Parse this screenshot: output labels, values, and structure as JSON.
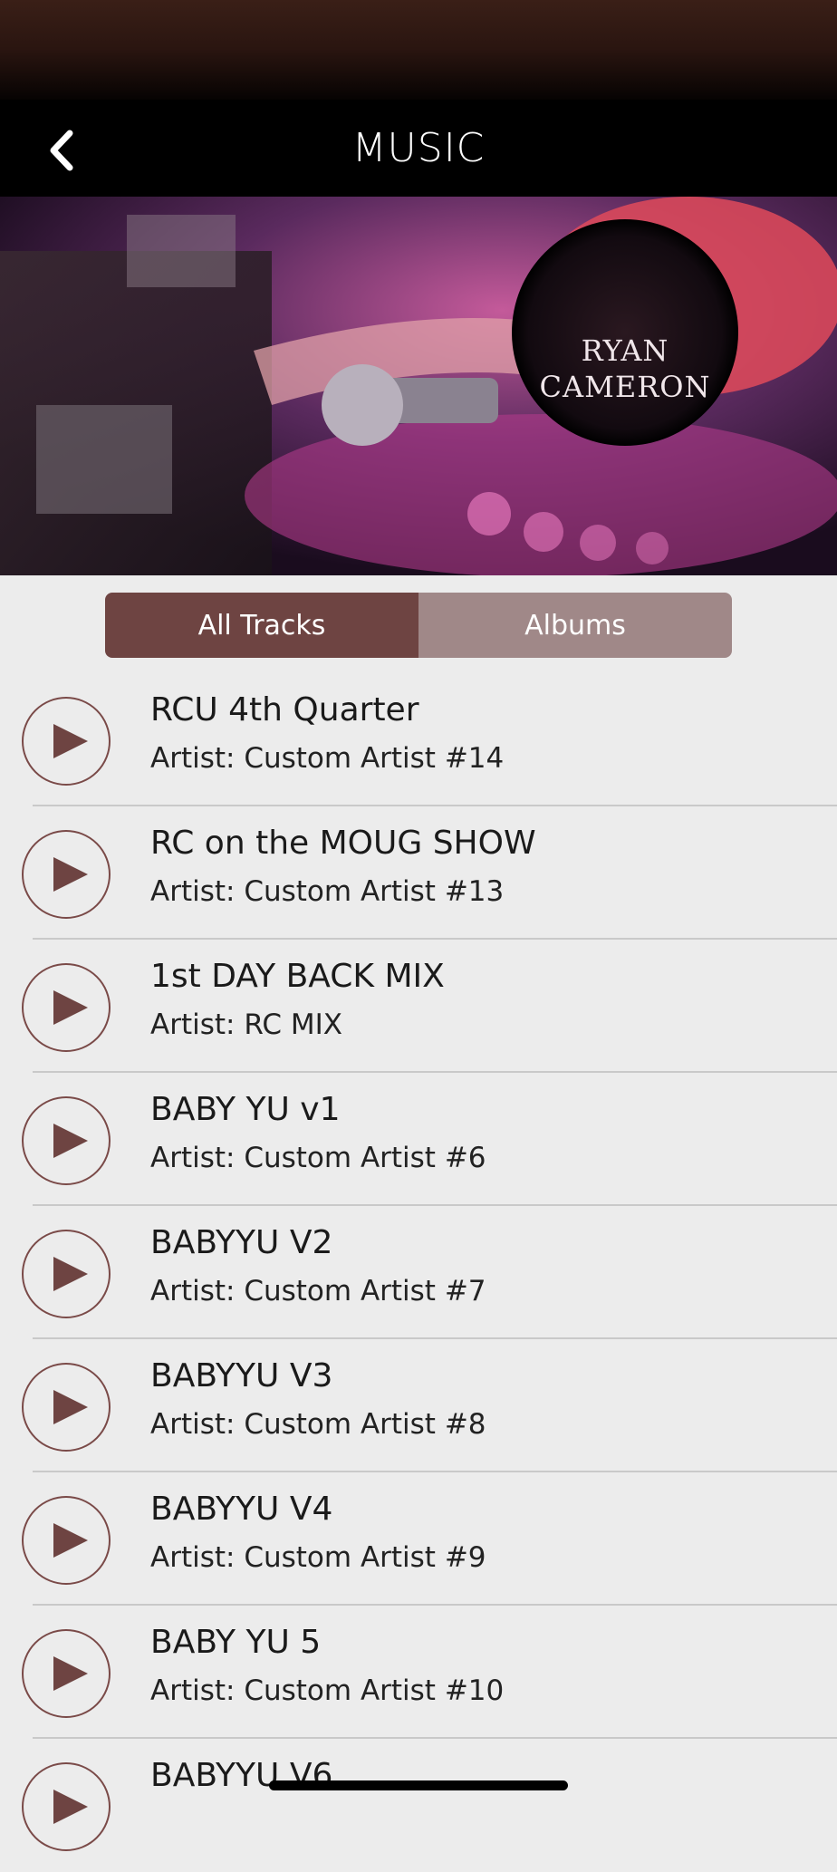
{
  "nav": {
    "title": "MUSIC"
  },
  "hero": {
    "logo_line1": "RYAN",
    "logo_line2": "CAMERON"
  },
  "tabs": [
    {
      "label": "All Tracks",
      "active": true
    },
    {
      "label": "Albums",
      "active": false
    }
  ],
  "tracks": [
    {
      "title": "RCU 4th Quarter",
      "artist": "Artist: Custom Artist #14"
    },
    {
      "title": "RC on the MOUG SHOW",
      "artist": "Artist: Custom Artist #13"
    },
    {
      "title": "1st DAY BACK MIX",
      "artist": "Artist: RC MIX"
    },
    {
      "title": "BABY YU v1",
      "artist": "Artist: Custom Artist #6"
    },
    {
      "title": "BABYYU V2",
      "artist": "Artist: Custom Artist #7"
    },
    {
      "title": "BABYYU V3",
      "artist": "Artist: Custom Artist #8"
    },
    {
      "title": "BABYYU V4",
      "artist": "Artist: Custom Artist #9"
    },
    {
      "title": "BABY YU 5",
      "artist": "Artist: Custom Artist #10"
    },
    {
      "title": "BABYYU V6",
      "artist": ""
    }
  ],
  "colors": {
    "accent": "#6e4442",
    "accent_light": "#a08888",
    "background": "#ececec"
  }
}
